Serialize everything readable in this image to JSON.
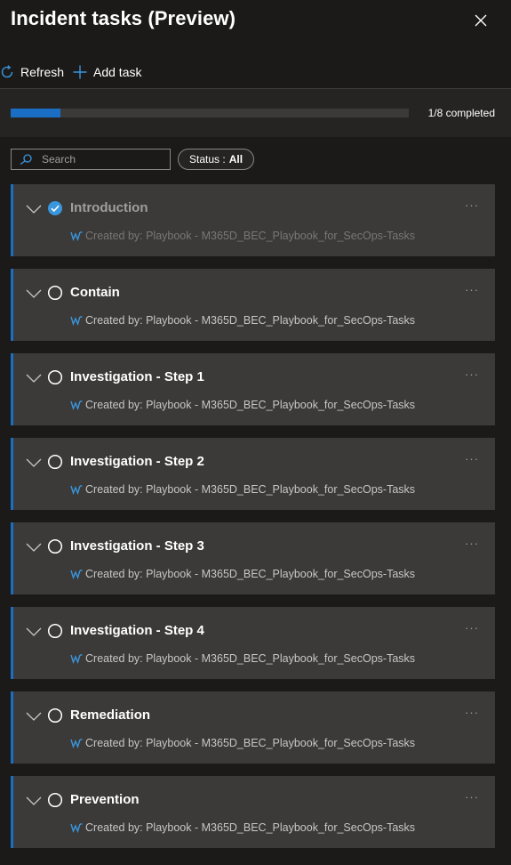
{
  "panel": {
    "title": "Incident tasks (Preview)"
  },
  "toolbar": {
    "refresh_label": "Refresh",
    "add_task_label": "Add task"
  },
  "progress": {
    "completed": 1,
    "total": 8,
    "text": "1/8 completed"
  },
  "filter": {
    "search_placeholder": "Search",
    "status_label": "Status :",
    "status_value": "All"
  },
  "colors": {
    "accent": "#1a6fc4",
    "card_background": "#3b3a39",
    "page_background": "#1b1a19"
  },
  "tasks": [
    {
      "title": "Introduction",
      "completed": true,
      "created_by": "Created by: Playbook - M365D_BEC_Playbook_for_SecOps-Tasks"
    },
    {
      "title": "Contain",
      "completed": false,
      "created_by": "Created by: Playbook - M365D_BEC_Playbook_for_SecOps-Tasks"
    },
    {
      "title": "Investigation - Step 1",
      "completed": false,
      "created_by": "Created by: Playbook - M365D_BEC_Playbook_for_SecOps-Tasks"
    },
    {
      "title": "Investigation - Step 2",
      "completed": false,
      "created_by": "Created by: Playbook - M365D_BEC_Playbook_for_SecOps-Tasks"
    },
    {
      "title": "Investigation - Step 3",
      "completed": false,
      "created_by": "Created by: Playbook - M365D_BEC_Playbook_for_SecOps-Tasks"
    },
    {
      "title": "Investigation - Step 4",
      "completed": false,
      "created_by": "Created by: Playbook - M365D_BEC_Playbook_for_SecOps-Tasks"
    },
    {
      "title": "Remediation",
      "completed": false,
      "created_by": "Created by: Playbook - M365D_BEC_Playbook_for_SecOps-Tasks"
    },
    {
      "title": "Prevention",
      "completed": false,
      "created_by": "Created by: Playbook - M365D_BEC_Playbook_for_SecOps-Tasks"
    }
  ]
}
